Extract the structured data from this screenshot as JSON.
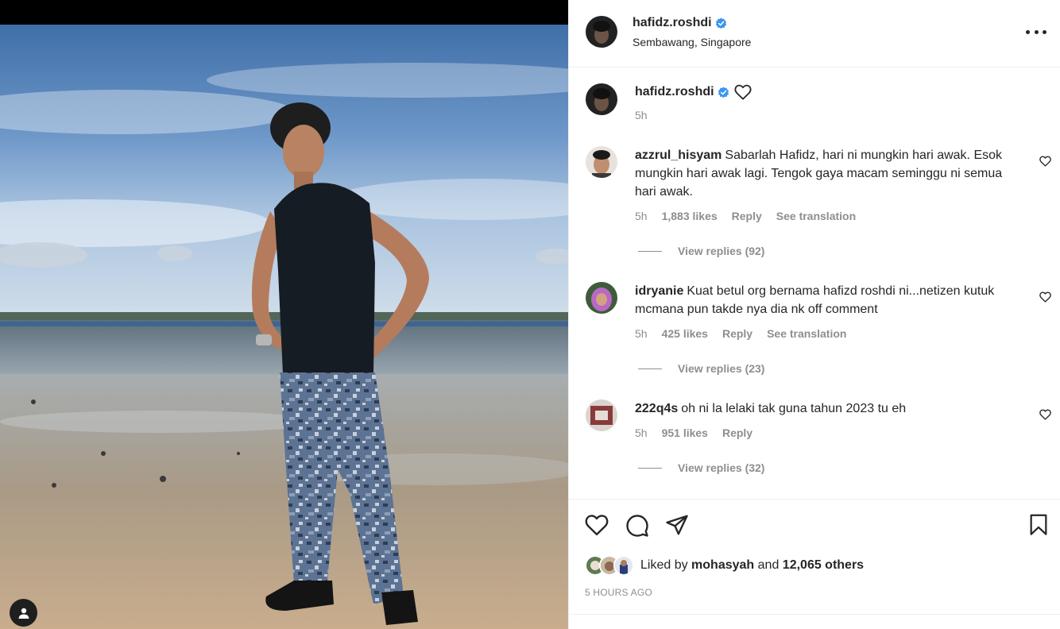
{
  "post": {
    "username": "hafidz.roshdi",
    "location": "Sembawang, Singapore",
    "caption_time": "5h"
  },
  "comments": [
    {
      "username": "azzrul_hisyam",
      "text": "Sabarlah Hafidz, hari ni mungkin hari awak. Esok mungkin hari awak lagi. Tengok gaya macam seminggu ni semua hari awak.",
      "time": "5h",
      "likes": "1,883 likes",
      "reply": "Reply",
      "translate": "See translation",
      "view_replies": "View replies (92)"
    },
    {
      "username": "idryanie",
      "text": "Kuat betul org bernama hafizd roshdi ni...netizen kutuk mcmana pun takde nya dia nk off comment",
      "time": "5h",
      "likes": "425 likes",
      "reply": "Reply",
      "translate": "See translation",
      "view_replies": "View replies (23)"
    },
    {
      "username": "222q4s",
      "text": "oh ni la lelaki tak guna tahun 2023 tu eh",
      "time": "5h",
      "likes": "951 likes",
      "reply": "Reply",
      "view_replies": "View replies (32)"
    }
  ],
  "likes": {
    "prefix": "Liked by",
    "first_liker": "mohasyah",
    "conjunction": "and",
    "others": "12,065 others"
  },
  "timestamp": "5 HOURS AGO",
  "icons": {
    "verified": "verified-badge-icon",
    "more": "more-options-icon",
    "like": "heart-icon",
    "comment": "comment-icon",
    "share": "share-icon",
    "save": "bookmark-icon",
    "user_tag": "user-tag-icon"
  },
  "colors": {
    "verified": "#3897f0",
    "secondary_text": "#8e8e8e",
    "primary_text": "#262626"
  }
}
